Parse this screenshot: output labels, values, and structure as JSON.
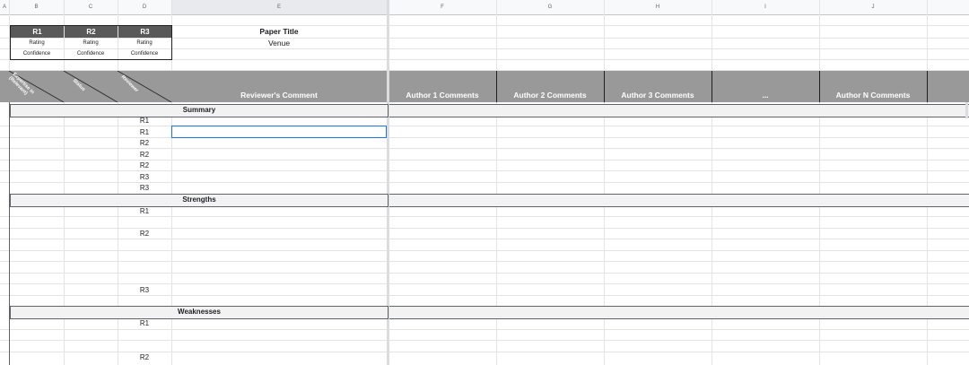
{
  "columns": [
    "A",
    "B",
    "C",
    "D",
    "E",
    "F",
    "G",
    "H",
    "I",
    "J"
  ],
  "header": {
    "reviewers": [
      "R1",
      "R2",
      "R3"
    ],
    "rating_label": "Rating",
    "confidence_label": "Confidence",
    "paper_title": "Paper Title",
    "venue": "Venue"
  },
  "table_header": {
    "diag_labels": [
      "Expertise in\n(Relevant)",
      "Status",
      "Reviewer"
    ],
    "reviewer_comment": "Reviewer's Comment",
    "author_columns": [
      "Author 1 Comments",
      "Author 2 Comments",
      "Author 3 Comments",
      "...",
      "Author N Comments"
    ]
  },
  "sections": [
    {
      "title": "Summary",
      "rows": [
        "R1",
        "R1",
        "R2",
        "R2",
        "R2",
        "R3",
        "R3"
      ]
    },
    {
      "title": "Strengths",
      "rows": [
        "R1",
        "R2",
        "R3"
      ]
    },
    {
      "title": "Weaknesses",
      "rows": [
        "R1",
        "R2"
      ]
    }
  ],
  "colors": {
    "dark_header": "#595959",
    "grey_header": "#999999",
    "selection": "#1a73e8"
  }
}
